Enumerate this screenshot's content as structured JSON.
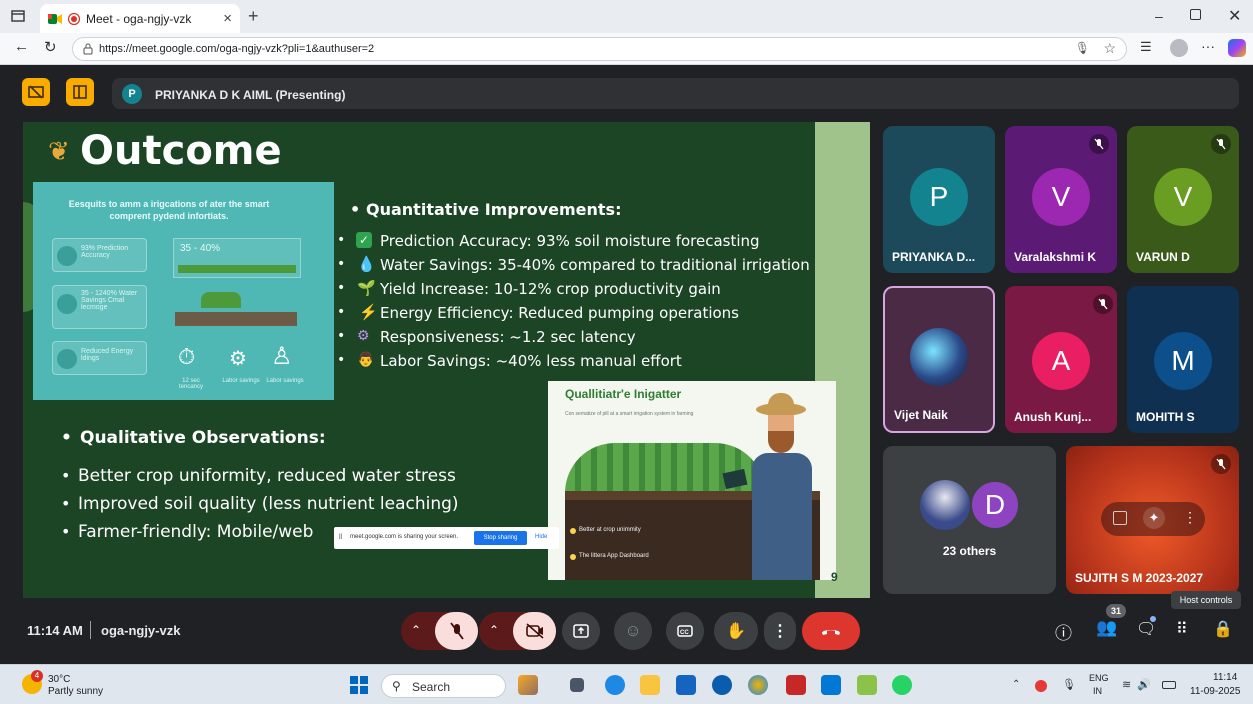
{
  "browser": {
    "tab_title": "Meet - oga-ngjy-vzk",
    "url": "https://meet.google.com/oga-ngjy-vzk?pli=1&authuser=2",
    "new_tab": "+",
    "tab_close": "×"
  },
  "meet": {
    "presenter_initial": "P",
    "presenter_label": "PRIYANKA D K AIML (Presenting)",
    "time": "11:14 AM",
    "meeting_code": "oga-ngjy-vzk",
    "people_count": "31",
    "host_controls_tooltip": "Host controls",
    "share_banner": {
      "text": "meet.google.com is sharing your screen.",
      "stop": "Stop sharing",
      "hide": "Hide"
    }
  },
  "slide": {
    "title": "Outcome",
    "quant_heading": "Quantitative Improvements:",
    "quant_items": [
      "Prediction Accuracy: 93% soil moisture forecasting",
      "Water Savings: 35-40% compared to traditional irrigation",
      "Yield Increase: 10-12% crop productivity gain",
      "Energy Efficiency: Reduced pumping operations",
      "Responsiveness: ~1.2 sec latency",
      "Labor Savings: ~40% less manual effort"
    ],
    "qual_heading": "Qualitative Observations:",
    "qual_items": [
      "Better crop uniformity, reduced water stress",
      "Improved soil quality (less nutrient leaching)",
      "Farmer-friendly: Mobile/web"
    ],
    "page_num": "9",
    "infographic": {
      "title": "Eesquits to amm a irigcations of ater the smart comprent pydend infortiats.",
      "items": [
        "93% Prediction Accuracy",
        "35 - 1240% Water Savings Cmal lecmoge",
        "Reduced Energy ldings"
      ],
      "range": "35 - 40%",
      "bottom_labels": [
        "12 sec tencancy",
        "Labor savings",
        "Labor savings"
      ]
    },
    "farmer_card": {
      "title": "Quallitiatr'e Inigatter",
      "subtitle": "Con sematize of pill at a smart irrigation system in farming",
      "bullets": [
        "Better at crop unimmity",
        "The littera App Dashboard"
      ]
    }
  },
  "participants": [
    {
      "name": "PRIYANKA D...",
      "initial": "P",
      "color": "#12838f",
      "muted": false
    },
    {
      "name": "Varalakshmi K",
      "initial": "V",
      "color": "#9c27b0",
      "muted": true
    },
    {
      "name": "VARUN D",
      "initial": "V",
      "color": "#6a9e22",
      "muted": true
    },
    {
      "name": "Vijet Naik",
      "initial": "",
      "color": "#5a2a55",
      "muted": false
    },
    {
      "name": "Anush Kunj...",
      "initial": "A",
      "color": "#e91e63",
      "muted": true
    },
    {
      "name": "MOHITH S",
      "initial": "M",
      "color": "#0d4f8a",
      "muted": false
    }
  ],
  "others": {
    "label": "23 others",
    "initial": "D"
  },
  "self_tile": {
    "name": "SUJITH S M 2023-2027"
  },
  "taskbar": {
    "temp": "30°C",
    "weather": "Partly sunny",
    "weather_badge": "4",
    "search": "Search",
    "lang1": "ENG",
    "lang2": "IN",
    "clock_time": "11:14",
    "clock_date": "11-09-2025"
  }
}
